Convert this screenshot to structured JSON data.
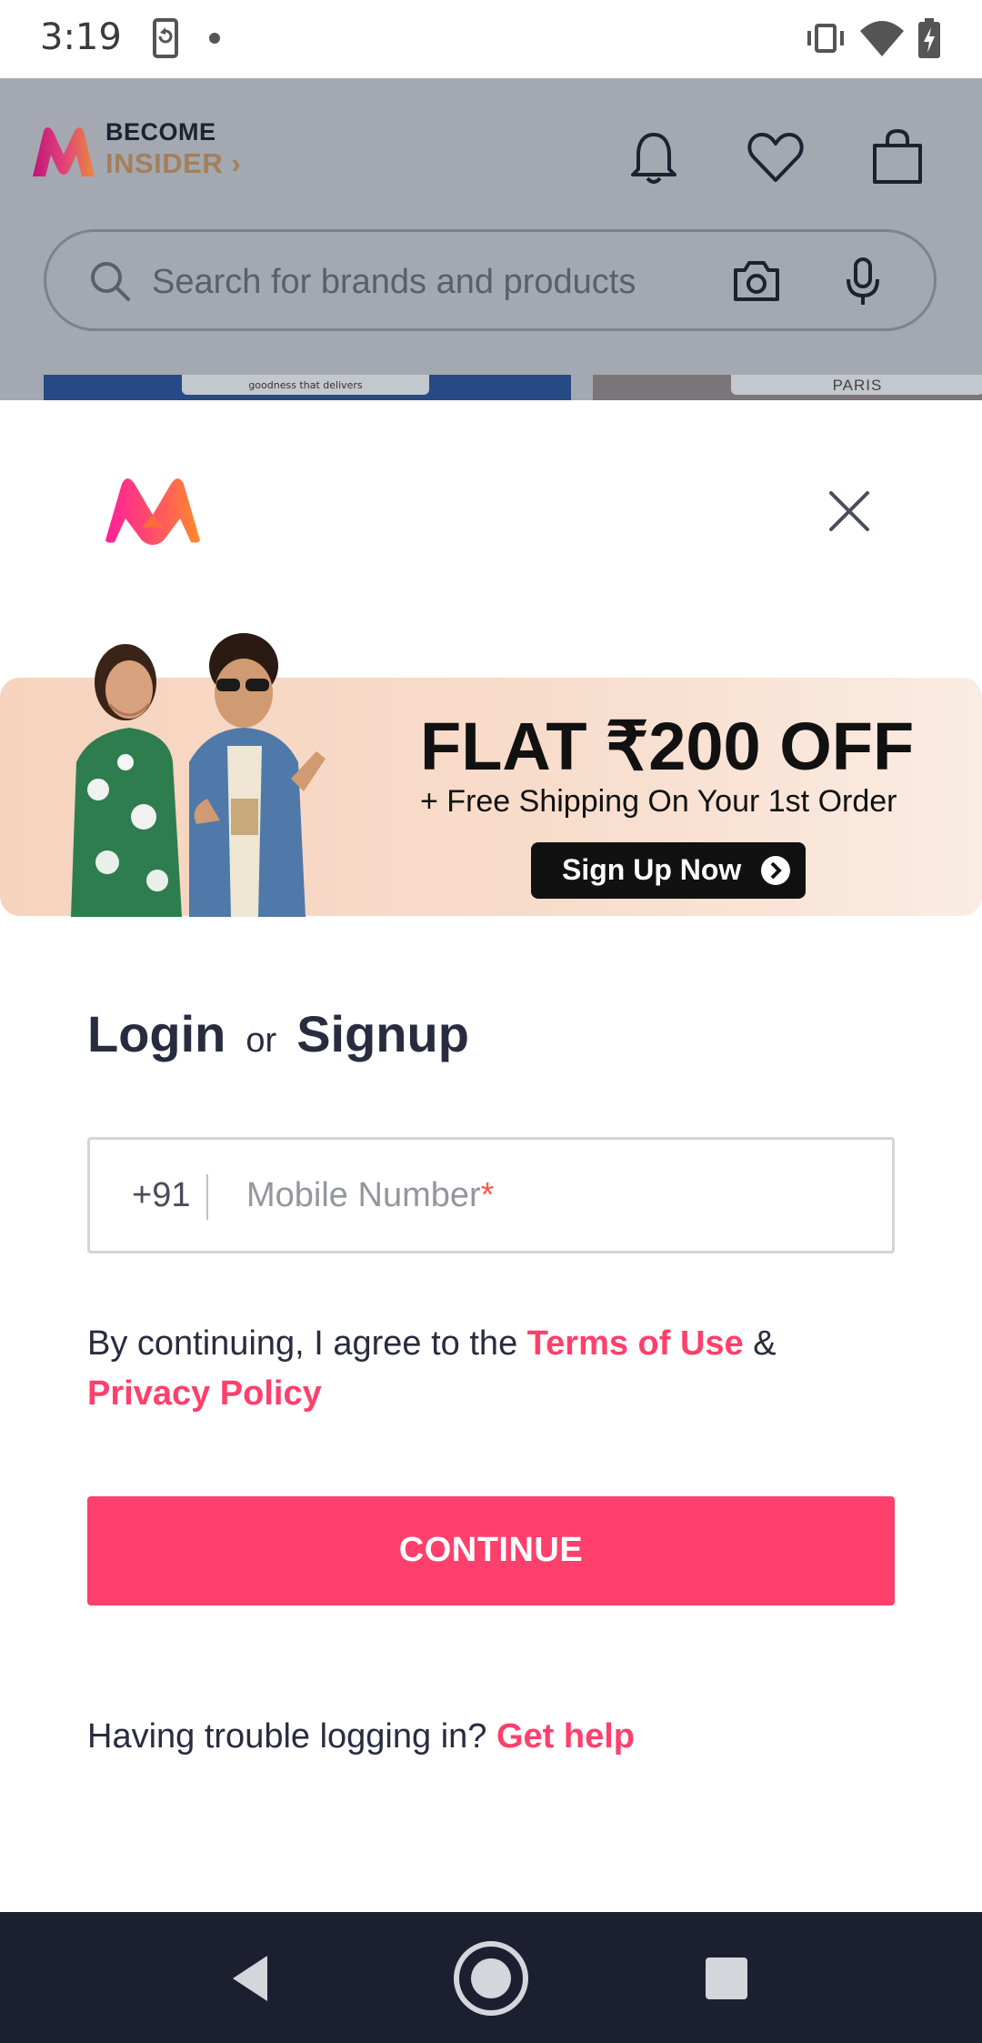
{
  "status_bar": {
    "time": "3:19",
    "icons": [
      "screen-rotate-icon",
      "notification-dot-icon",
      "vibrate-icon",
      "wifi-icon",
      "battery-charging-icon"
    ]
  },
  "background_app": {
    "become_label": "BECOME",
    "insider_label": "INSIDER",
    "search_placeholder": "Search for brands and products",
    "peek_left_text": "goodness that delivers",
    "peek_right_text": "PARIS",
    "icons": [
      "bell-icon",
      "heart-icon",
      "bag-icon",
      "search-icon",
      "camera-icon",
      "mic-icon"
    ]
  },
  "modal": {
    "banner": {
      "title": "FLAT ₹200 OFF",
      "subtitle": "+ Free Shipping On Your 1st Order",
      "cta": "Sign Up Now"
    },
    "heading": {
      "login": "Login",
      "or": "or",
      "signup": "Signup"
    },
    "phone": {
      "country_code": "+91",
      "placeholder": "Mobile Number",
      "required_mark": "*"
    },
    "terms": {
      "prefix": "By continuing, I agree to the ",
      "terms_link": "Terms of Use",
      "amp": " &",
      "privacy_link": "Privacy Policy"
    },
    "continue_label": "CONTINUE",
    "help": {
      "prefix": "Having trouble logging in? ",
      "link": "Get help"
    }
  },
  "colors": {
    "accent": "#ff3f6c",
    "text": "#282c3f",
    "nav_bar": "#1c1f2f",
    "overlay_bg": "#a4a8b1"
  }
}
